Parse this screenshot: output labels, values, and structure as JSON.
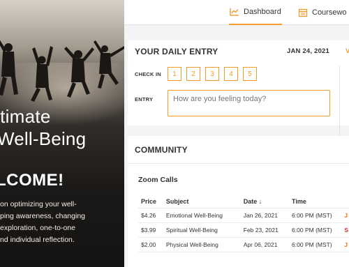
{
  "hero": {
    "title_line1": "ltimate",
    "title_line2": "Well-Being",
    "welcome": "LCOME!",
    "blurb_lines": [
      "on optimizing your well-",
      "ping awareness, changing",
      " exploration, one-to-one",
      "nd individual reflection."
    ]
  },
  "nav": {
    "tabs": [
      {
        "label": "Dashboard",
        "icon": "chart-line-icon",
        "active": true
      },
      {
        "label": "Coursewo",
        "icon": "calendar-icon",
        "active": false
      }
    ]
  },
  "entry": {
    "title": "YOUR DAILY ENTRY",
    "date": "JAN 24, 2021",
    "view_link": "V",
    "checkin_label": "CHECK IN",
    "checkin_options": [
      "1",
      "2",
      "3",
      "4",
      "5"
    ],
    "entry_label": "ENTRY",
    "entry_placeholder": "How are you feeling today?"
  },
  "community": {
    "title": "COMMUNITY",
    "subhead": "Zoom Calls",
    "columns": [
      "Price",
      "Subject",
      "Date ↓",
      "Time"
    ],
    "rows": [
      {
        "price": "$4.26",
        "subject": "Emotional Well-Being",
        "date": "Jan 26, 2021",
        "time": "6:00 PM (MST)",
        "action": "J"
      },
      {
        "price": "$3.99",
        "subject": "Spiritual Well-Being",
        "date": "Feb 23, 2021",
        "time": "6:00 PM (MST)",
        "action": "S"
      },
      {
        "price": "$2.00",
        "subject": "Physical Well-Being",
        "date": "Apr 06, 2021",
        "time": "6:00 PM (MST)",
        "action": "J"
      }
    ]
  },
  "colors": {
    "accent": "#f39b2b",
    "action": "#e0701d",
    "action_red": "#d2302c"
  }
}
